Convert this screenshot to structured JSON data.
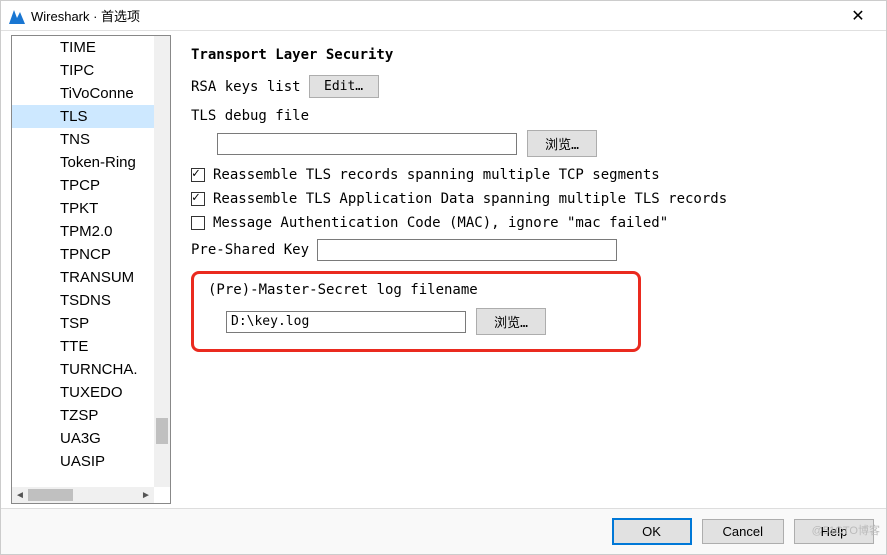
{
  "window": {
    "title": "Wireshark · 首选项"
  },
  "sidebar": {
    "items": [
      {
        "label": "TIME"
      },
      {
        "label": "TIPC"
      },
      {
        "label": "TiVoConne"
      },
      {
        "label": "TLS",
        "selected": true
      },
      {
        "label": "TNS"
      },
      {
        "label": "Token-Ring"
      },
      {
        "label": "TPCP"
      },
      {
        "label": "TPKT"
      },
      {
        "label": "TPM2.0"
      },
      {
        "label": "TPNCP"
      },
      {
        "label": "TRANSUM"
      },
      {
        "label": "TSDNS"
      },
      {
        "label": "TSP"
      },
      {
        "label": "TTE"
      },
      {
        "label": "TURNCHA."
      },
      {
        "label": "TUXEDO"
      },
      {
        "label": "TZSP"
      },
      {
        "label": "UA3G"
      },
      {
        "label": "UASIP"
      }
    ]
  },
  "main": {
    "title": "Transport Layer Security",
    "rsa_label": "RSA keys list",
    "edit_btn": "Edit…",
    "debug_label": "TLS debug file",
    "debug_value": "",
    "browse1": "浏览…",
    "chk1": "Reassemble TLS records spanning multiple TCP segments",
    "chk2": "Reassemble TLS Application Data spanning multiple TLS records",
    "chk3": "Message Authentication Code (MAC), ignore \"mac failed\"",
    "psk_label": "Pre-Shared Key",
    "psk_value": "",
    "master_label": "(Pre)-Master-Secret log filename",
    "master_value": "D:\\key.log",
    "browse2": "浏览…"
  },
  "footer": {
    "ok": "OK",
    "cancel": "Cancel",
    "help": "Help"
  },
  "watermark": "@51CTO博客"
}
